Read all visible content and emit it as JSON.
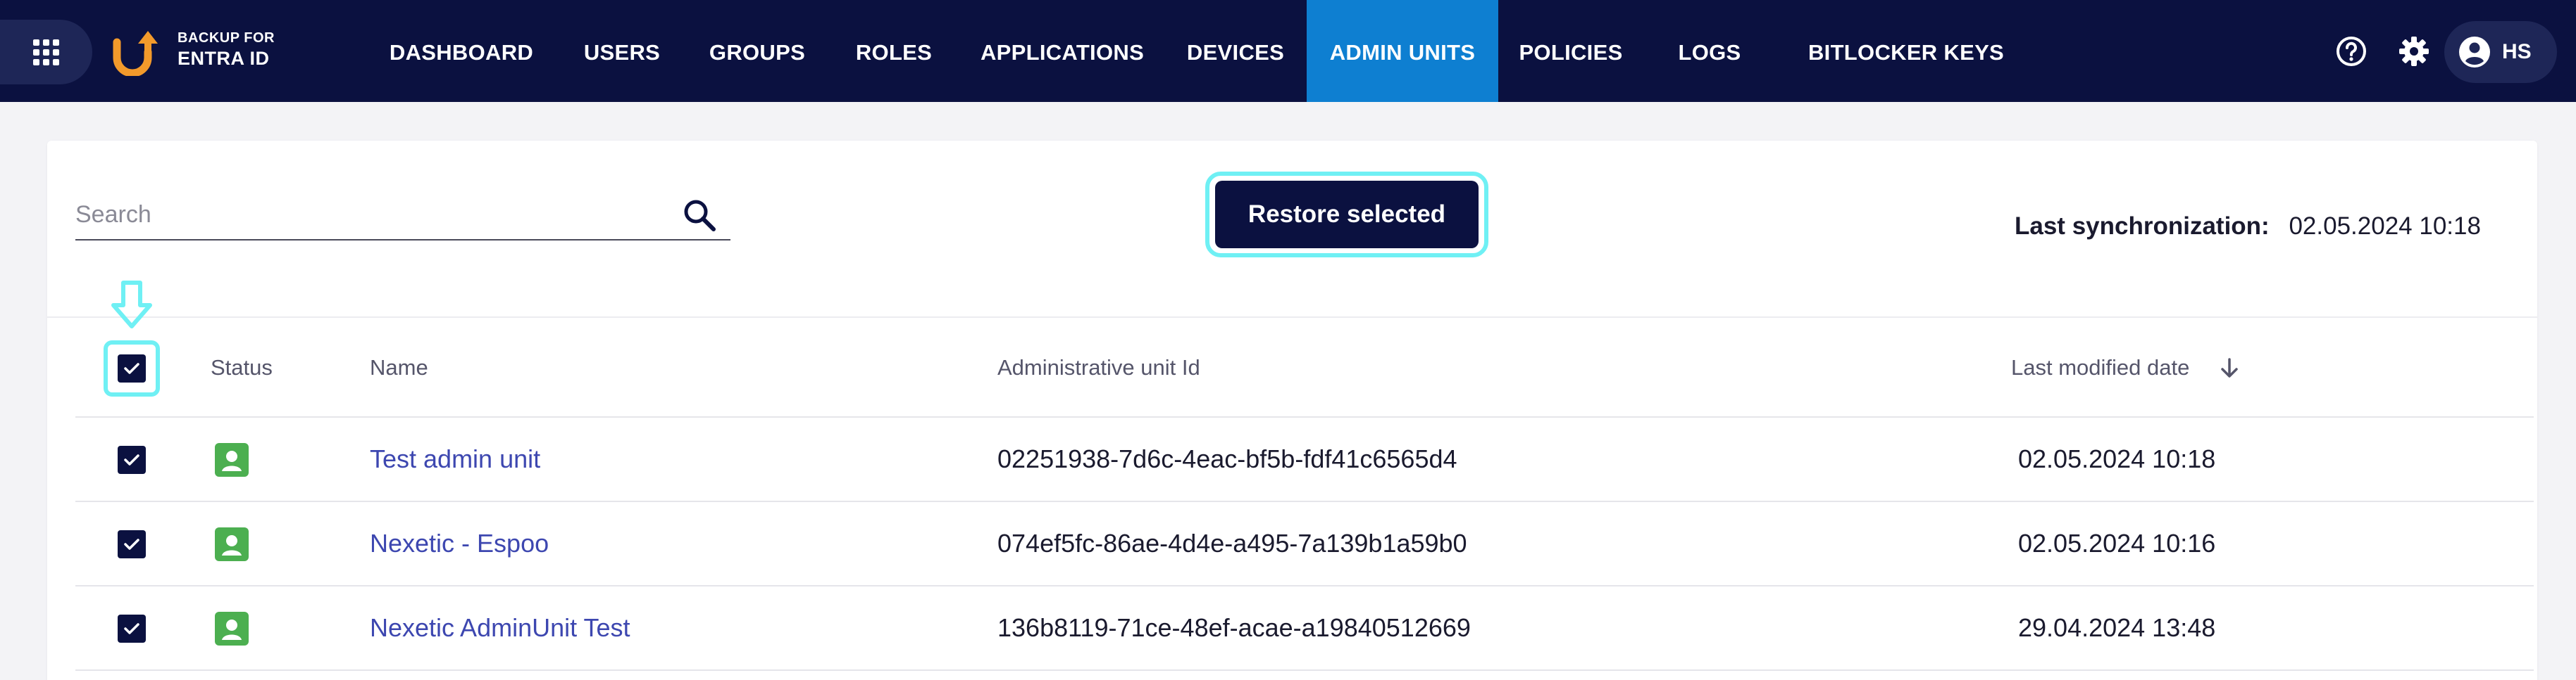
{
  "brand": {
    "line1": "BACKUP FOR",
    "line2": "ENTRA ID"
  },
  "nav": {
    "items": [
      {
        "label": "DASHBOARD",
        "active": false
      },
      {
        "label": "USERS",
        "active": false
      },
      {
        "label": "GROUPS",
        "active": false
      },
      {
        "label": "ROLES",
        "active": false
      },
      {
        "label": "APPLICATIONS",
        "active": false
      },
      {
        "label": "DEVICES",
        "active": false
      },
      {
        "label": "ADMIN UNITS",
        "active": true
      },
      {
        "label": "POLICIES",
        "active": false
      },
      {
        "label": "LOGS",
        "active": false
      },
      {
        "label": "BITLOCKER KEYS",
        "active": false
      }
    ],
    "user_initials": "HS"
  },
  "search": {
    "placeholder": "Search",
    "value": ""
  },
  "toolbar": {
    "restore_label": "Restore selected"
  },
  "sync": {
    "label": "Last synchronization:",
    "value": "02.05.2024 10:18"
  },
  "table": {
    "headers": {
      "status": "Status",
      "name": "Name",
      "unit_id": "Administrative unit Id",
      "modified": "Last modified date"
    },
    "rows": [
      {
        "name": "Test admin unit",
        "unit_id": "02251938-7d6c-4eac-bf5b-fdf41c6565d4",
        "modified": "02.05.2024 10:18",
        "checked": true
      },
      {
        "name": "Nexetic - Espoo",
        "unit_id": "074ef5fc-86ae-4d4e-a495-7a139b1a59b0",
        "modified": "02.05.2024 10:16",
        "checked": true
      },
      {
        "name": "Nexetic AdminUnit Test",
        "unit_id": "136b8119-71ce-48ef-acae-a19840512669",
        "modified": "29.04.2024 13:48",
        "checked": true
      }
    ]
  },
  "colors": {
    "nav_bg": "#0b1140",
    "nav_active": "#0e7fd1",
    "highlight": "#6ff0f4",
    "status_green": "#4caf50",
    "link": "#3d47b0",
    "logo_orange": "#f39a2b"
  },
  "icons": {
    "apps": "grid-icon",
    "logo": "backup-logo-icon",
    "help": "help-icon",
    "settings": "gear-icon",
    "user": "account-icon",
    "search": "search-icon",
    "sort": "arrow-down-icon",
    "status": "admin-unit-status-icon"
  }
}
